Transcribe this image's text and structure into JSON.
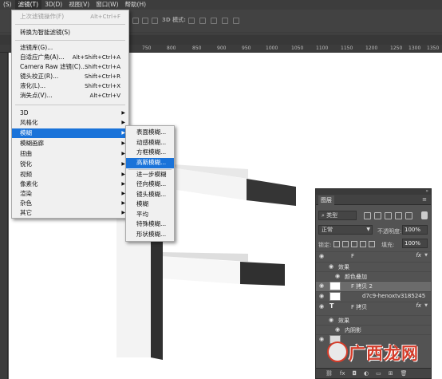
{
  "menubar": {
    "items": [
      {
        "label": "(S)"
      },
      {
        "label": "滤镜(T)",
        "active": true
      },
      {
        "label": "3D(D)"
      },
      {
        "label": "视图(V)"
      },
      {
        "label": "窗口(W)"
      },
      {
        "label": "帮助(H)"
      }
    ]
  },
  "options_bar": {
    "mode3d": "3D 模式:"
  },
  "ruler": {
    "ticks": [
      "750",
      "800",
      "850",
      "900",
      "950",
      "1000",
      "1050",
      "1100",
      "1150",
      "1200",
      "1250",
      "1300",
      "1350"
    ]
  },
  "filter_menu": {
    "last_filter": {
      "label": "上次滤镜操作(F)",
      "shortcut": "Alt+Ctrl+F"
    },
    "smart": {
      "label": "转换为智能滤镜(S)"
    },
    "gallery": {
      "label": "滤镜库(G)..."
    },
    "adaptive_wide": {
      "label": "自适应广角(A)...",
      "shortcut": "Alt+Shift+Ctrl+A"
    },
    "camera_raw": {
      "label": "Camera Raw 滤镜(C)...",
      "shortcut": "Shift+Ctrl+A"
    },
    "lens": {
      "label": "镜头校正(R)...",
      "shortcut": "Shift+Ctrl+R"
    },
    "liquify": {
      "label": "液化(L)...",
      "shortcut": "Shift+Ctrl+X"
    },
    "vanishing": {
      "label": "消失点(V)...",
      "shortcut": "Alt+Ctrl+V"
    },
    "categories": [
      "3D",
      "风格化",
      "模糊",
      "模糊画廊",
      "扭曲",
      "锐化",
      "视频",
      "像素化",
      "渲染",
      "杂色",
      "其它"
    ],
    "highlighted_category": "模糊"
  },
  "blur_submenu": {
    "items": [
      "表面模糊...",
      "动感模糊...",
      "方框模糊...",
      "高斯模糊...",
      "进一步模糊",
      "径向模糊...",
      "镜头模糊...",
      "模糊",
      "平均",
      "特殊模糊...",
      "形状模糊..."
    ],
    "highlighted": "高斯模糊..."
  },
  "layers_panel": {
    "tab": "图层",
    "filter_kind": "类型",
    "blend_mode": "正常",
    "opacity_label": "不透明度:",
    "opacity": "100%",
    "lock_label": "锁定:",
    "fill_label": "填充:",
    "fill": "100%",
    "layers": [
      {
        "name": "F",
        "fx": "fx"
      },
      {
        "name": "效果"
      },
      {
        "name": "颜色叠加"
      },
      {
        "name": "F 拷贝 2",
        "selected": true
      },
      {
        "name": "d7c9-henoxtv3185245"
      },
      {
        "name": "F 拷贝",
        "fx": "fx"
      },
      {
        "name": "效果"
      },
      {
        "name": "内阴影"
      }
    ]
  },
  "watermark": {
    "text": "广西龙网"
  },
  "colors": {
    "accent": "#1a73d9",
    "watermark": "#d53c2a"
  }
}
